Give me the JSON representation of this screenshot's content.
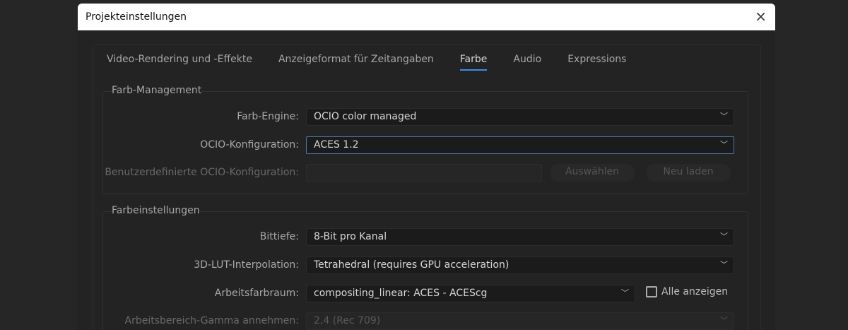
{
  "dialog": {
    "title": "Projekteinstellungen",
    "close_icon": "×"
  },
  "tabs": [
    {
      "label": "Video-Rendering und -Effekte"
    },
    {
      "label": "Anzeigeformat für Zeitangaben"
    },
    {
      "label": "Farbe"
    },
    {
      "label": "Audio"
    },
    {
      "label": "Expressions"
    }
  ],
  "active_tab": "Farbe",
  "accent": "#3a8ee6",
  "color_management": {
    "title": "Farb-Management",
    "engine_label": "Farb-Engine:",
    "engine_value": "OCIO color managed",
    "ocio_label": "OCIO-Konfiguration:",
    "ocio_value": "ACES 1.2",
    "custom_label": "Benutzerdefinierte OCIO-Konfiguration:",
    "custom_value": "",
    "choose_button": "Auswählen",
    "reload_button": "Neu laden"
  },
  "color_settings": {
    "title": "Farbeinstellungen",
    "bitdepth_label": "Bittiefe:",
    "bitdepth_value": "8-Bit pro Kanal",
    "lut_label": "3D-LUT-Interpolation:",
    "lut_value": "Tetrahedral (requires GPU acceleration)",
    "workspace_label": "Arbeitsfarbraum:",
    "workspace_value": "compositing_linear: ACES - ACEScg",
    "show_all_label": "Alle anzeigen",
    "show_all_checked": false,
    "gamma_label": "Arbeitsbereich-Gamma annehmen:",
    "gamma_value": "2,4 (Rec 709)"
  }
}
